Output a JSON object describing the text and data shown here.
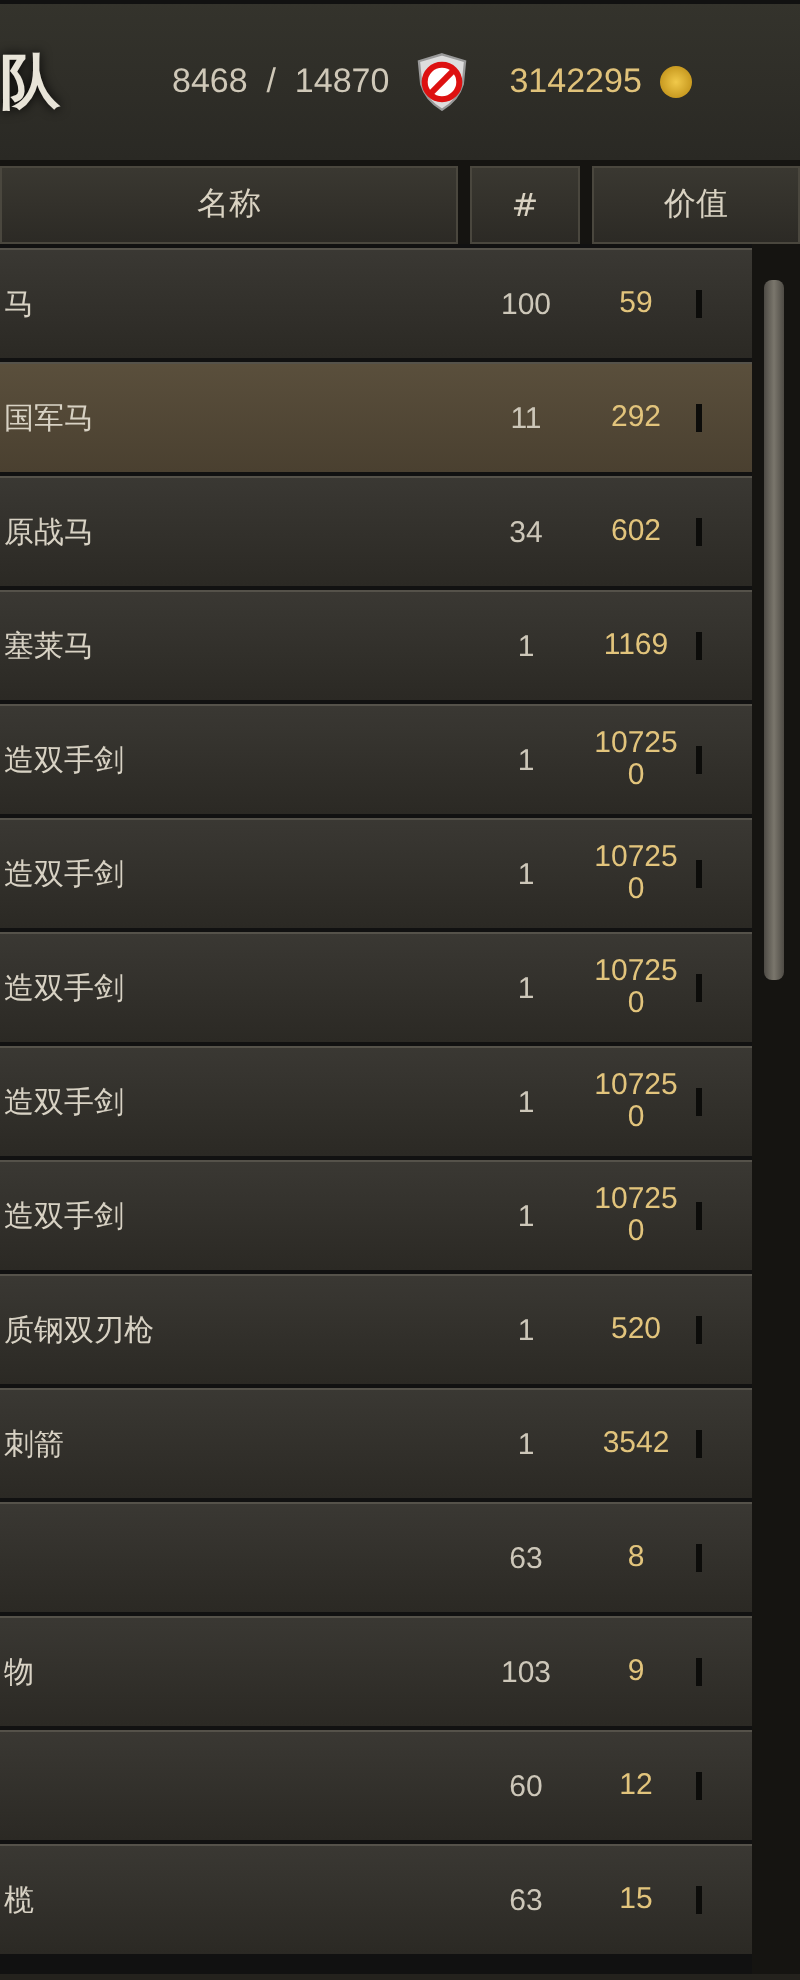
{
  "title": "队",
  "troops": {
    "current": "8468",
    "separator": "/",
    "max": "14870"
  },
  "gold": "3142295",
  "columns": [
    "名称",
    "#",
    "价值"
  ],
  "rows": [
    {
      "name": "马",
      "count": "100",
      "value": "59",
      "selected": false
    },
    {
      "name": "国军马",
      "count": "11",
      "value": "292",
      "selected": true
    },
    {
      "name": "原战马",
      "count": "34",
      "value": "602",
      "selected": false
    },
    {
      "name": "塞莱马",
      "count": "1",
      "value": "1169",
      "selected": false
    },
    {
      "name": "造双手剑",
      "count": "1",
      "value": "107250",
      "selected": false
    },
    {
      "name": "造双手剑",
      "count": "1",
      "value": "107250",
      "selected": false
    },
    {
      "name": "造双手剑",
      "count": "1",
      "value": "107250",
      "selected": false
    },
    {
      "name": "造双手剑",
      "count": "1",
      "value": "107250",
      "selected": false
    },
    {
      "name": "造双手剑",
      "count": "1",
      "value": "107250",
      "selected": false
    },
    {
      "name": "质钢双刃枪",
      "count": "1",
      "value": "520",
      "selected": false
    },
    {
      "name": "刺箭",
      "count": "1",
      "value": "3542",
      "selected": false
    },
    {
      "count": "63",
      "value": "8",
      "selected": false
    },
    {
      "name": "物",
      "count": "103",
      "value": "9",
      "selected": false
    },
    {
      "count": "60",
      "value": "12",
      "selected": false
    },
    {
      "name": "榄",
      "count": "63",
      "value": "15",
      "selected": false
    }
  ]
}
